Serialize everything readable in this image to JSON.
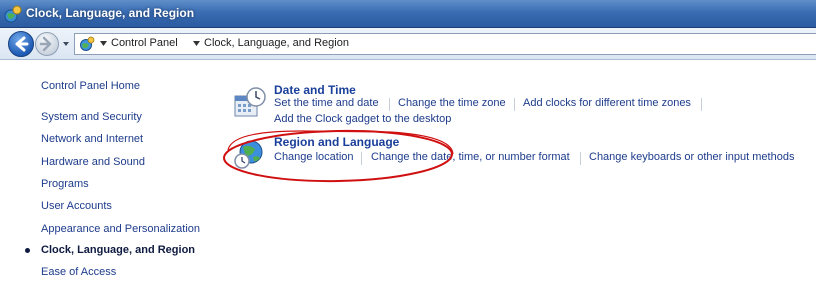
{
  "window": {
    "title": "Clock, Language, and Region",
    "title_icon": "control-panel-icon"
  },
  "address_bar": {
    "icon": "control-panel-globe-icon",
    "breadcrumbs": [
      "Control Panel",
      "Clock, Language, and Region"
    ]
  },
  "left_nav": {
    "items": [
      {
        "label": "Control Panel Home"
      },
      {
        "label": "System and Security"
      },
      {
        "label": "Network and Internet"
      },
      {
        "label": "Hardware and Sound"
      },
      {
        "label": "Programs"
      },
      {
        "label": "User Accounts"
      },
      {
        "label": "Appearance and Personalization"
      },
      {
        "label": "Clock, Language, and Region",
        "current": true
      },
      {
        "label": "Ease of Access"
      }
    ]
  },
  "categories": [
    {
      "title": "Date and Time",
      "icon": "calendar-clock-icon",
      "tasks": [
        "Set the time and date",
        "Change the time zone",
        "Add clocks for different time zones",
        "Add the Clock gadget to the desktop"
      ]
    },
    {
      "title": "Region and Language",
      "icon": "globe-clock-icon",
      "tasks": [
        "Change location",
        "Change the date, time, or number format",
        "Change keyboards or other input methods"
      ]
    }
  ],
  "colors": {
    "link": "#1e3c8c",
    "heading": "#1a3f9a",
    "annotation_circle": "#d01010"
  }
}
